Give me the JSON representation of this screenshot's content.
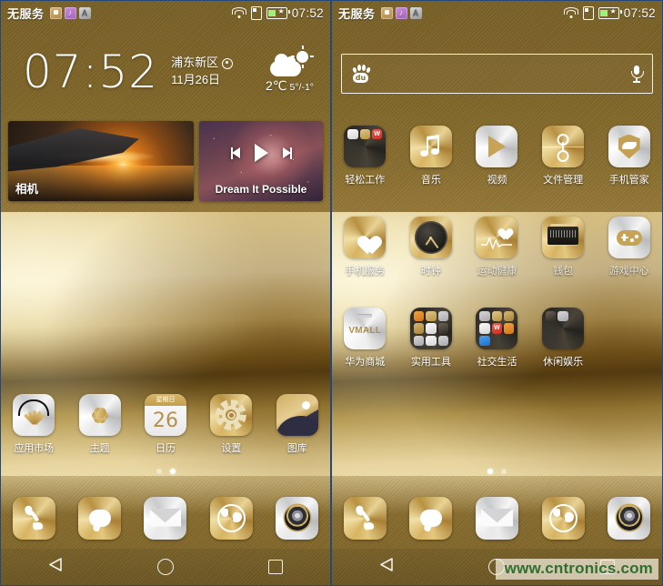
{
  "status_bar": {
    "carrier": "无服务",
    "time": "07:52",
    "notification_icons": [
      "notification-icon-tan",
      "notification-icon-music",
      "notification-icon-input"
    ],
    "signal_icons": [
      "wifi-icon",
      "sim-icon",
      "battery-icon"
    ]
  },
  "left_screen": {
    "clock_widget": {
      "time": "07:52",
      "location": "浦东新区",
      "date": "11月26日",
      "weather": {
        "icon": "partly-cloudy-icon",
        "current_temp": "2℃",
        "range": "5°/-1°"
      }
    },
    "cards": {
      "camera": {
        "label": "相机"
      },
      "music": {
        "title": "Dream It Possible",
        "controls": [
          "previous-track",
          "play",
          "next-track"
        ]
      }
    },
    "apps": [
      {
        "label": "应用市场",
        "icon": "huawei-appmarket-icon"
      },
      {
        "label": "主题",
        "icon": "themes-icon"
      },
      {
        "label": "日历",
        "icon": "calendar-icon",
        "day": "26",
        "weekday": "星期日"
      },
      {
        "label": "设置",
        "icon": "settings-gear-icon"
      },
      {
        "label": "图库",
        "icon": "gallery-icon"
      }
    ],
    "page_dots": {
      "count": 2,
      "active": 1
    }
  },
  "right_screen": {
    "search": {
      "engine_icon": "baidu-paw-icon",
      "placeholder": "",
      "value": "",
      "voice_icon": "microphone-icon"
    },
    "apps": [
      {
        "label": "轻松工作",
        "icon": "folder-icon",
        "type": "folder"
      },
      {
        "label": "音乐",
        "icon": "music-note-icon"
      },
      {
        "label": "视频",
        "icon": "video-play-icon"
      },
      {
        "label": "文件管理",
        "icon": "file-manager-icon"
      },
      {
        "label": "手机管家",
        "icon": "phone-manager-shield-icon"
      },
      {
        "label": "手机服务",
        "icon": "phone-service-heart-icon"
      },
      {
        "label": "时钟",
        "icon": "clock-icon"
      },
      {
        "label": "运动健康",
        "icon": "health-icon"
      },
      {
        "label": "钱包",
        "icon": "wallet-icon"
      },
      {
        "label": "游戏中心",
        "icon": "game-center-icon"
      },
      {
        "label": "华为商城",
        "icon": "vmall-icon",
        "brand": "VMALL"
      },
      {
        "label": "实用工具",
        "icon": "folder-icon",
        "type": "folder"
      },
      {
        "label": "社交生活",
        "icon": "folder-icon",
        "type": "folder"
      },
      {
        "label": "休闲娱乐",
        "icon": "folder-icon",
        "type": "folder"
      }
    ],
    "page_dots": {
      "count": 2,
      "active": 0
    }
  },
  "dock": [
    {
      "label": "phone",
      "icon": "phone-dialer-icon"
    },
    {
      "label": "messages",
      "icon": "messages-bubble-icon"
    },
    {
      "label": "email",
      "icon": "email-envelope-icon"
    },
    {
      "label": "browser",
      "icon": "browser-globe-icon"
    },
    {
      "label": "camera",
      "icon": "camera-lens-icon"
    }
  ],
  "nav_bar": {
    "back": "back-triangle-icon",
    "home": "home-circle-icon",
    "recents": "recents-square-icon"
  },
  "watermark": "www.cntronics.com",
  "colors": {
    "gold": "#c6a356",
    "gold_light": "#efe2b4",
    "gold_dark": "#7a6229",
    "watermark_green": "#2f6f2f"
  }
}
